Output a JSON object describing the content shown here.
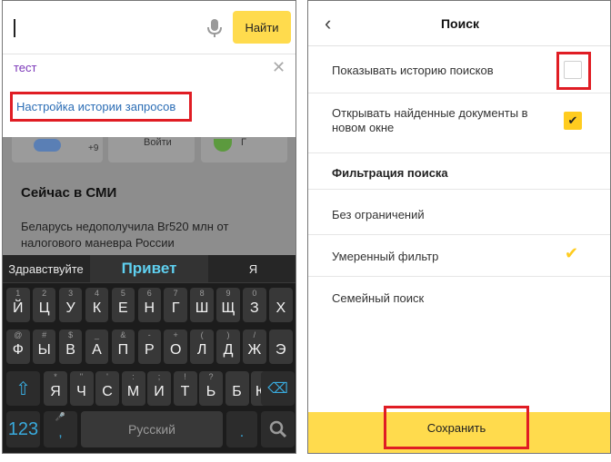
{
  "left": {
    "search": {
      "find_button": "Найти",
      "mic_icon": "microphone-icon"
    },
    "dropdown": {
      "suggestion": "тест",
      "clear_icon": "close-icon",
      "history_settings_link": "Настройка истории запросов"
    },
    "widgets": {
      "counter": "+9",
      "login": "Войти",
      "extra": "Г"
    },
    "news_title": "Сейчас в СМИ",
    "news_item": "Беларусь недополучила Br520 млн от налогового маневра России",
    "keyboard": {
      "suggestions": [
        "Здравствуйте",
        "Привет",
        "Я"
      ],
      "row1": [
        [
          "1",
          "Й"
        ],
        [
          "2",
          "Ц"
        ],
        [
          "3",
          "У"
        ],
        [
          "4",
          "К"
        ],
        [
          "5",
          "Е"
        ],
        [
          "6",
          "Н"
        ],
        [
          "7",
          "Г"
        ],
        [
          "8",
          "Ш"
        ],
        [
          "9",
          "Щ"
        ],
        [
          "0",
          "З"
        ],
        [
          "",
          "Х"
        ]
      ],
      "row2": [
        [
          "@",
          "Ф"
        ],
        [
          "#",
          "Ы"
        ],
        [
          "$",
          "В"
        ],
        [
          "_",
          "А"
        ],
        [
          "&",
          "П"
        ],
        [
          "-",
          "Р"
        ],
        [
          "+",
          "О"
        ],
        [
          "(",
          "Л"
        ],
        [
          ")",
          "Д"
        ],
        [
          "/",
          "Ж"
        ],
        [
          "",
          "Э"
        ]
      ],
      "row3": [
        [
          "*",
          "Я"
        ],
        [
          "\"",
          "Ч"
        ],
        [
          "'",
          "С"
        ],
        [
          ":",
          "М"
        ],
        [
          ";",
          "И"
        ],
        [
          "!",
          "Т"
        ],
        [
          "?",
          "Ь"
        ],
        [
          "",
          "Б"
        ],
        [
          "",
          "Ю"
        ]
      ],
      "shift_icon": "shift-icon",
      "backspace_icon": "backspace-icon",
      "numbers_key": "123",
      "comma_key": ",",
      "space_label": "Русский",
      "period_key": ".",
      "search_icon": "search-icon"
    }
  },
  "right": {
    "title": "Поиск",
    "back_icon": "chevron-left-icon",
    "show_history_label": "Показывать историю поисков",
    "open_new_window_label": "Открывать найденные документы в новом окне",
    "filter_section": "Фильтрация поиска",
    "filters": [
      "Без ограничений",
      "Умеренный фильтр",
      "Семейный поиск"
    ],
    "selected_filter": "Умеренный фильтр",
    "save_button": "Сохранить"
  },
  "colors": {
    "accent_yellow": "#ffdb4d",
    "highlight_red": "#e01d24",
    "link_blue": "#2b6db5"
  }
}
